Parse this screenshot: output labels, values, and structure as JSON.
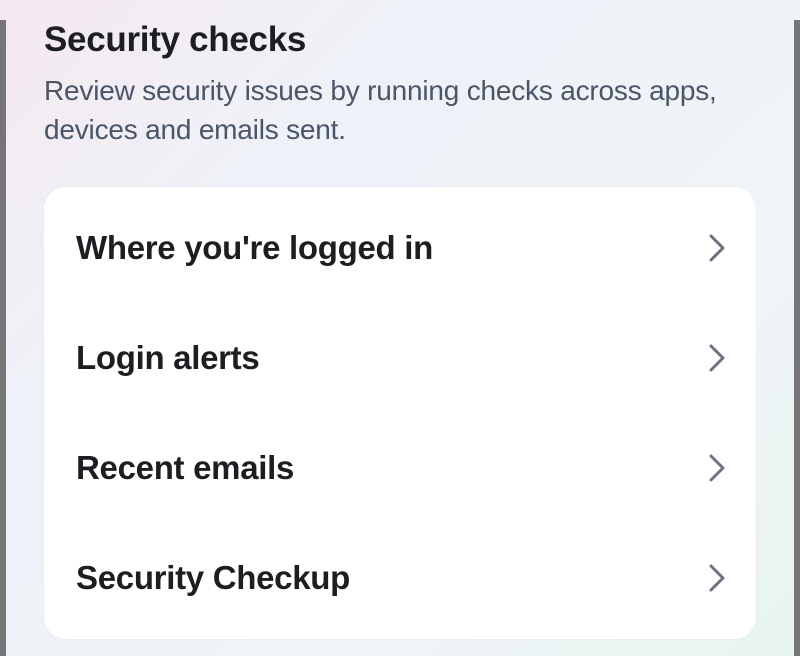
{
  "section": {
    "title": "Security checks",
    "description": "Review security issues by running checks across apps, devices and emails sent."
  },
  "items": [
    {
      "label": "Where you're logged in"
    },
    {
      "label": "Login alerts"
    },
    {
      "label": "Recent emails"
    },
    {
      "label": "Security Checkup"
    }
  ]
}
